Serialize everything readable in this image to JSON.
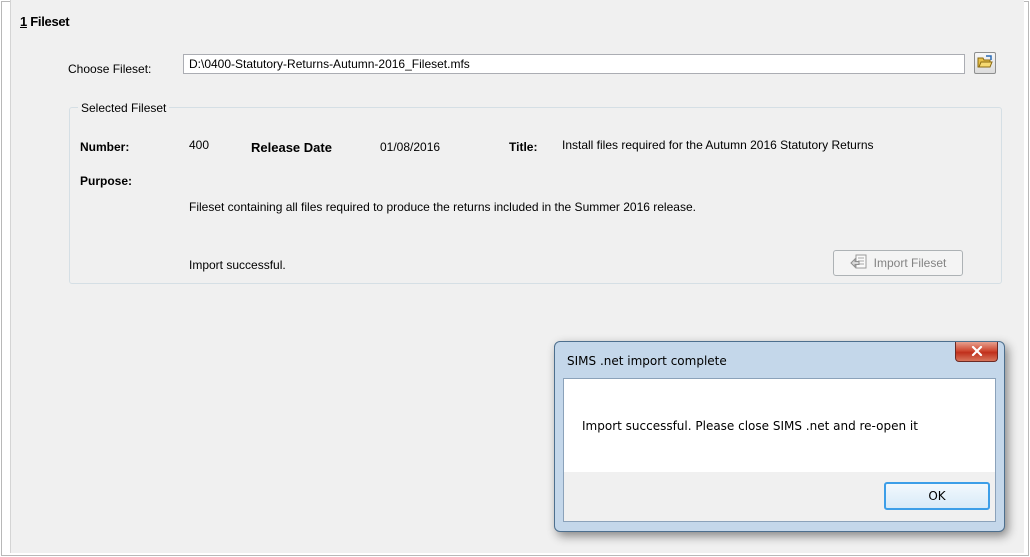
{
  "section": {
    "number": "1",
    "title": "Fileset"
  },
  "choose": {
    "label": "Choose Fileset:",
    "path": "D:\\0400-Statutory-Returns-Autumn-2016_Fileset.mfs",
    "browse_icon": "folder-open-icon"
  },
  "selected": {
    "legend": "Selected Fileset",
    "number_label": "Number:",
    "number_value": "400",
    "release_label": "Release Date",
    "release_value": "01/08/2016",
    "title_label": "Title:",
    "title_value": "Install files required for the Autumn 2016 Statutory Returns",
    "purpose_label": "Purpose:",
    "purpose_value": "Fileset containing all files required to produce the returns included in the Summer 2016 release.",
    "status": "Import successful.",
    "import_button": "Import Fileset",
    "import_icon": "import-icon"
  },
  "dialog": {
    "title": "SIMS .net import complete",
    "message": "Import successful. Please close SIMS .net and re-open it",
    "ok_label": "OK",
    "close_icon": "close-icon"
  },
  "colors": {
    "panel_bg": "#f0f0f0",
    "dialog_frame": "#c4d7ea",
    "close_red": "#c0301c",
    "ok_border": "#3c9ee8"
  }
}
